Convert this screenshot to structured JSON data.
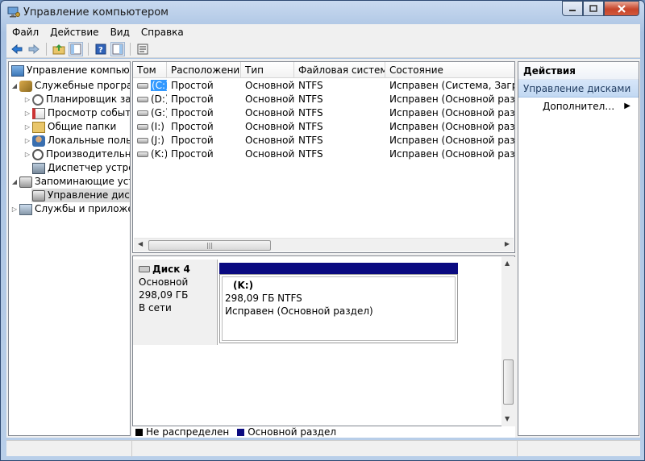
{
  "window": {
    "title": "Управление компьютером"
  },
  "menu": [
    "Файл",
    "Действие",
    "Вид",
    "Справка"
  ],
  "toolbar": {
    "icons": [
      "back-arrow-icon",
      "forward-arrow-icon",
      "up-folder-icon",
      "show-tree-icon",
      "help-icon",
      "show-action-pane-icon",
      "properties-icon"
    ]
  },
  "tree": {
    "root": "Управление компьютером (локальным)",
    "nodes": [
      {
        "label": "Служебные программы",
        "icon": "tools-icon",
        "level": 1
      },
      {
        "label": "Планировщик заданий",
        "icon": "clock-icon",
        "level": 2
      },
      {
        "label": "Просмотр событий",
        "icon": "event-viewer-icon",
        "level": 2
      },
      {
        "label": "Общие папки",
        "icon": "shared-folder-icon",
        "level": 2
      },
      {
        "label": "Локальные пользователи",
        "icon": "users-icon",
        "level": 2
      },
      {
        "label": "Производительность",
        "icon": "performance-icon",
        "level": 2
      },
      {
        "label": "Диспетчер устройств",
        "icon": "device-manager-icon",
        "level": 2
      },
      {
        "label": "Запоминающие устройства",
        "icon": "storage-icon",
        "level": 1
      },
      {
        "label": "Управление дисками",
        "icon": "disk-management-icon",
        "level": 2
      },
      {
        "label": "Службы и приложения",
        "icon": "services-icon",
        "level": 1
      }
    ]
  },
  "volumes": {
    "columns": [
      "Том",
      "Расположение",
      "Тип",
      "Файловая система",
      "Состояние"
    ],
    "rows": [
      [
        "(C:)",
        "Простой",
        "Основной",
        "NTFS",
        "Исправен (Система, Загрузка)"
      ],
      [
        "(D:)",
        "Простой",
        "Основной",
        "NTFS",
        "Исправен (Основной раздел)"
      ],
      [
        "(G:)",
        "Простой",
        "Основной",
        "NTFS",
        "Исправен (Основной раздел)"
      ],
      [
        "(I:)",
        "Простой",
        "Основной",
        "NTFS",
        "Исправен (Основной раздел)"
      ],
      [
        "(J:)",
        "Простой",
        "Основной",
        "NTFS",
        "Исправен (Основной раздел)"
      ],
      [
        "(K:)",
        "Простой",
        "Основной",
        "NTFS",
        "Исправен (Основной раздел)"
      ]
    ]
  },
  "disk": {
    "name": "Диск 4",
    "type": "Основной",
    "size": "298,09 ГБ",
    "status": "В сети",
    "partition": {
      "name": "(K:)",
      "size_fs": "298,09 ГБ NTFS",
      "status": "Исправен (Основной раздел)",
      "color": "#0a0a80"
    }
  },
  "legend": [
    {
      "label": "Не распределен",
      "color": "#000000"
    },
    {
      "label": "Основной раздел",
      "color": "#0a0a80"
    }
  ],
  "actions": {
    "header": "Действия",
    "section": "Управление дисками",
    "item": "Дополнительные действия"
  }
}
